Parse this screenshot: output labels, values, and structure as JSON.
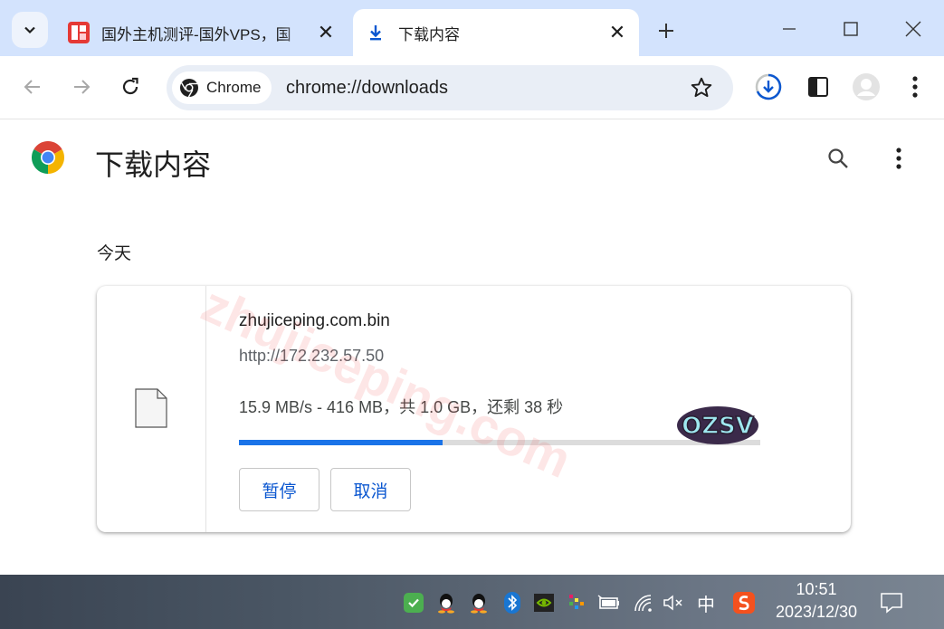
{
  "tabs": [
    {
      "title": "国外主机测评-国外VPS，国",
      "active": false
    },
    {
      "title": "下载内容",
      "active": true
    }
  ],
  "omnibox": {
    "chip_label": "Chrome",
    "url": "chrome://downloads"
  },
  "page": {
    "title": "下载内容",
    "date_header": "今天",
    "watermark": "zhujiceping.com",
    "sticker_text": "OZSV"
  },
  "download": {
    "file_name": "zhujiceping.com.bin",
    "url": "http://172.232.57.50",
    "status": "15.9 MB/s - 416 MB，共 1.0 GB，还剩 38 秒",
    "progress_fraction": 0.39,
    "pause_label": "暂停",
    "cancel_label": "取消"
  },
  "taskbar": {
    "ime_label": "中",
    "time": "10:51",
    "date": "2023/12/30"
  },
  "colors": {
    "tabstrip": "#d3e3fd",
    "accent": "#1a73e8",
    "button_text": "#0b57d0"
  }
}
